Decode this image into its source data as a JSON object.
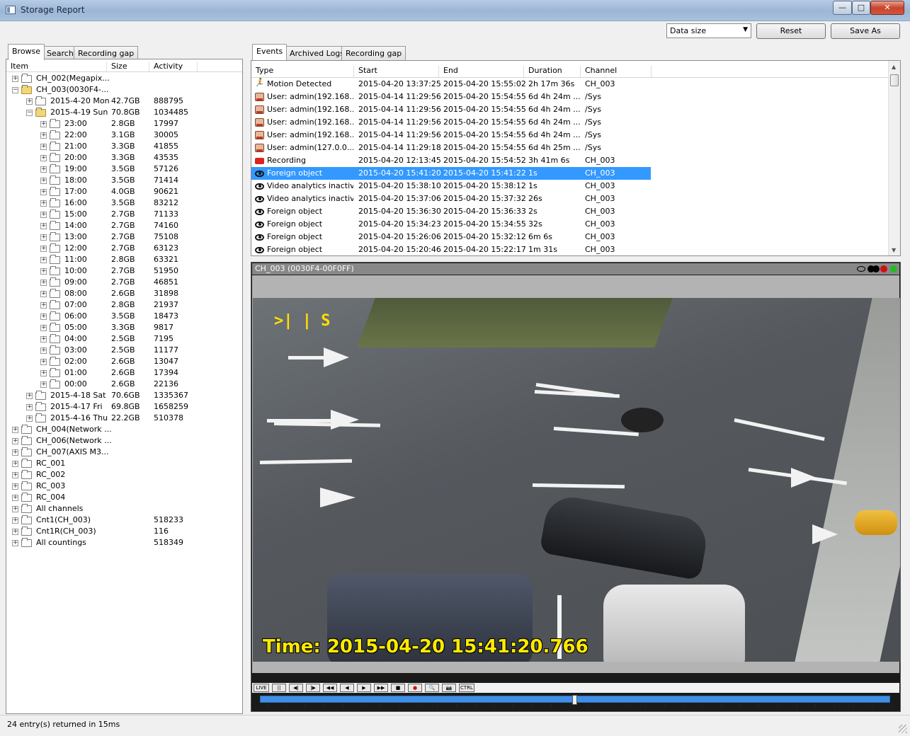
{
  "window": {
    "title": "Storage Report",
    "min": "—",
    "max": "□",
    "close": "✕"
  },
  "toolbar": {
    "datasize_value": "Data size",
    "reset_label": "Reset",
    "saveas_label": "Save As"
  },
  "left_tabs": [
    "Browse",
    "Search",
    "Recording gap"
  ],
  "tree_columns": [
    "Item",
    "Size",
    "Activity"
  ],
  "tree": [
    {
      "depth": 0,
      "exp": "+",
      "open": false,
      "name": "CH_002(Megapix...",
      "size": "",
      "activity": ""
    },
    {
      "depth": 0,
      "exp": "−",
      "open": true,
      "name": "CH_003(0030F4-...",
      "size": "",
      "activity": ""
    },
    {
      "depth": 1,
      "exp": "+",
      "open": false,
      "name": "2015-4-20 Mon",
      "size": "42.7GB",
      "activity": "888795"
    },
    {
      "depth": 1,
      "exp": "−",
      "open": true,
      "name": "2015-4-19 Sun",
      "size": "70.8GB",
      "activity": "1034485"
    },
    {
      "depth": 2,
      "exp": "+",
      "open": false,
      "name": "23:00",
      "size": "2.8GB",
      "activity": "17997"
    },
    {
      "depth": 2,
      "exp": "+",
      "open": false,
      "name": "22:00",
      "size": "3.1GB",
      "activity": "30005"
    },
    {
      "depth": 2,
      "exp": "+",
      "open": false,
      "name": "21:00",
      "size": "3.3GB",
      "activity": "41855"
    },
    {
      "depth": 2,
      "exp": "+",
      "open": false,
      "name": "20:00",
      "size": "3.3GB",
      "activity": "43535"
    },
    {
      "depth": 2,
      "exp": "+",
      "open": false,
      "name": "19:00",
      "size": "3.5GB",
      "activity": "57126"
    },
    {
      "depth": 2,
      "exp": "+",
      "open": false,
      "name": "18:00",
      "size": "3.5GB",
      "activity": "71414"
    },
    {
      "depth": 2,
      "exp": "+",
      "open": false,
      "name": "17:00",
      "size": "4.0GB",
      "activity": "90621"
    },
    {
      "depth": 2,
      "exp": "+",
      "open": false,
      "name": "16:00",
      "size": "3.5GB",
      "activity": "83212"
    },
    {
      "depth": 2,
      "exp": "+",
      "open": false,
      "name": "15:00",
      "size": "2.7GB",
      "activity": "71133"
    },
    {
      "depth": 2,
      "exp": "+",
      "open": false,
      "name": "14:00",
      "size": "2.7GB",
      "activity": "74160"
    },
    {
      "depth": 2,
      "exp": "+",
      "open": false,
      "name": "13:00",
      "size": "2.7GB",
      "activity": "75108"
    },
    {
      "depth": 2,
      "exp": "+",
      "open": false,
      "name": "12:00",
      "size": "2.7GB",
      "activity": "63123"
    },
    {
      "depth": 2,
      "exp": "+",
      "open": false,
      "name": "11:00",
      "size": "2.8GB",
      "activity": "63321"
    },
    {
      "depth": 2,
      "exp": "+",
      "open": false,
      "name": "10:00",
      "size": "2.7GB",
      "activity": "51950"
    },
    {
      "depth": 2,
      "exp": "+",
      "open": false,
      "name": "09:00",
      "size": "2.7GB",
      "activity": "46851"
    },
    {
      "depth": 2,
      "exp": "+",
      "open": false,
      "name": "08:00",
      "size": "2.6GB",
      "activity": "31898"
    },
    {
      "depth": 2,
      "exp": "+",
      "open": false,
      "name": "07:00",
      "size": "2.8GB",
      "activity": "21937"
    },
    {
      "depth": 2,
      "exp": "+",
      "open": false,
      "name": "06:00",
      "size": "3.5GB",
      "activity": "18473"
    },
    {
      "depth": 2,
      "exp": "+",
      "open": false,
      "name": "05:00",
      "size": "3.3GB",
      "activity": "9817"
    },
    {
      "depth": 2,
      "exp": "+",
      "open": false,
      "name": "04:00",
      "size": "2.5GB",
      "activity": "7195"
    },
    {
      "depth": 2,
      "exp": "+",
      "open": false,
      "name": "03:00",
      "size": "2.5GB",
      "activity": "11177"
    },
    {
      "depth": 2,
      "exp": "+",
      "open": false,
      "name": "02:00",
      "size": "2.6GB",
      "activity": "13047"
    },
    {
      "depth": 2,
      "exp": "+",
      "open": false,
      "name": "01:00",
      "size": "2.6GB",
      "activity": "17394"
    },
    {
      "depth": 2,
      "exp": "+",
      "open": false,
      "name": "00:00",
      "size": "2.6GB",
      "activity": "22136"
    },
    {
      "depth": 1,
      "exp": "+",
      "open": false,
      "name": "2015-4-18 Sat",
      "size": "70.6GB",
      "activity": "1335367"
    },
    {
      "depth": 1,
      "exp": "+",
      "open": false,
      "name": "2015-4-17 Fri",
      "size": "69.8GB",
      "activity": "1658259"
    },
    {
      "depth": 1,
      "exp": "+",
      "open": false,
      "name": "2015-4-16 Thu",
      "size": "22.2GB",
      "activity": "510378"
    },
    {
      "depth": 0,
      "exp": "+",
      "open": false,
      "name": "CH_004(Network ...",
      "size": "",
      "activity": ""
    },
    {
      "depth": 0,
      "exp": "+",
      "open": false,
      "name": "CH_006(Network ...",
      "size": "",
      "activity": ""
    },
    {
      "depth": 0,
      "exp": "+",
      "open": false,
      "name": "CH_007(AXIS M3...",
      "size": "",
      "activity": ""
    },
    {
      "depth": 0,
      "exp": "+",
      "open": false,
      "name": "RC_001",
      "size": "",
      "activity": ""
    },
    {
      "depth": 0,
      "exp": "+",
      "open": false,
      "name": "RC_002",
      "size": "",
      "activity": ""
    },
    {
      "depth": 0,
      "exp": "+",
      "open": false,
      "name": "RC_003",
      "size": "",
      "activity": ""
    },
    {
      "depth": 0,
      "exp": "+",
      "open": false,
      "name": "RC_004",
      "size": "",
      "activity": ""
    },
    {
      "depth": 0,
      "exp": "+",
      "open": false,
      "name": "All channels",
      "size": "",
      "activity": ""
    },
    {
      "depth": 0,
      "exp": "+",
      "open": false,
      "name": "Cnt1(CH_003)",
      "size": "",
      "activity": "518233"
    },
    {
      "depth": 0,
      "exp": "+",
      "open": false,
      "name": "Cnt1R(CH_003)",
      "size": "",
      "activity": "116"
    },
    {
      "depth": 0,
      "exp": "+",
      "open": false,
      "name": "All countings",
      "size": "",
      "activity": "518349"
    }
  ],
  "right_tabs": [
    "Events",
    "Archived Logs",
    "Recording gap"
  ],
  "event_columns": [
    "Type",
    "Start",
    "End",
    "Duration",
    "Channel"
  ],
  "events": [
    {
      "icon": "run-icon",
      "type": "Motion Detected",
      "start": "2015-04-20 13:37:25",
      "end": "2015-04-20 15:55:02",
      "duration": "2h 17m 36s",
      "channel": "CH_003",
      "selected": false
    },
    {
      "icon": "user-icon",
      "type": "User: admin(192.168....",
      "start": "2015-04-14 11:29:56",
      "end": "2015-04-20 15:54:55",
      "duration": "6d 4h 24m ...",
      "channel": "/Sys",
      "selected": false
    },
    {
      "icon": "user-icon",
      "type": "User: admin(192.168....",
      "start": "2015-04-14 11:29:56",
      "end": "2015-04-20 15:54:55",
      "duration": "6d 4h 24m ...",
      "channel": "/Sys",
      "selected": false
    },
    {
      "icon": "user-icon",
      "type": "User: admin(192.168....",
      "start": "2015-04-14 11:29:56",
      "end": "2015-04-20 15:54:55",
      "duration": "6d 4h 24m ...",
      "channel": "/Sys",
      "selected": false
    },
    {
      "icon": "user-icon",
      "type": "User: admin(192.168....",
      "start": "2015-04-14 11:29:56",
      "end": "2015-04-20 15:54:55",
      "duration": "6d 4h 24m ...",
      "channel": "/Sys",
      "selected": false
    },
    {
      "icon": "user-icon",
      "type": "User: admin(127.0.0....",
      "start": "2015-04-14 11:29:18",
      "end": "2015-04-20 15:54:55",
      "duration": "6d 4h 25m ...",
      "channel": "/Sys",
      "selected": false
    },
    {
      "icon": "recording-icon",
      "type": "Recording",
      "start": "2015-04-20 12:13:45",
      "end": "2015-04-20 15:54:52",
      "duration": "3h 41m 6s",
      "channel": "CH_003",
      "selected": false
    },
    {
      "icon": "eye-icon",
      "type": "Foreign object",
      "start": "2015-04-20 15:41:20",
      "end": "2015-04-20 15:41:22",
      "duration": "1s",
      "channel": "CH_003",
      "selected": true
    },
    {
      "icon": "eye-icon",
      "type": "Video analytics inactive",
      "start": "2015-04-20 15:38:10",
      "end": "2015-04-20 15:38:12",
      "duration": "1s",
      "channel": "CH_003",
      "selected": false
    },
    {
      "icon": "eye-icon",
      "type": "Video analytics inactive",
      "start": "2015-04-20 15:37:06",
      "end": "2015-04-20 15:37:32",
      "duration": "26s",
      "channel": "CH_003",
      "selected": false
    },
    {
      "icon": "eye-icon",
      "type": "Foreign object",
      "start": "2015-04-20 15:36:30",
      "end": "2015-04-20 15:36:33",
      "duration": "2s",
      "channel": "CH_003",
      "selected": false
    },
    {
      "icon": "eye-icon",
      "type": "Foreign object",
      "start": "2015-04-20 15:34:23",
      "end": "2015-04-20 15:34:55",
      "duration": "32s",
      "channel": "CH_003",
      "selected": false
    },
    {
      "icon": "eye-icon",
      "type": "Foreign object",
      "start": "2015-04-20 15:26:06",
      "end": "2015-04-20 15:32:12",
      "duration": "6m 6s",
      "channel": "CH_003",
      "selected": false
    },
    {
      "icon": "eye-icon",
      "type": "Foreign object",
      "start": "2015-04-20 15:20:46",
      "end": "2015-04-20 15:22:17",
      "duration": "1m 31s",
      "channel": "CH_003",
      "selected": false
    }
  ],
  "video": {
    "title": "CH_003 (0030F4-00F0FF)",
    "hud": ">| | S",
    "timestamp": "Time: 2015-04-20 15:41:20.766",
    "status_dots": [
      "#000000",
      "#000000",
      "#d01010",
      "#22bb22"
    ],
    "controls": [
      "LIVE",
      "||",
      "◀|",
      "|▶",
      "◀◀",
      "◀",
      "▶",
      "▶▶",
      "■",
      "●",
      "🔍",
      "📷",
      "CTRL"
    ]
  },
  "status": {
    "text": "24 entry(s) returned in 15ms"
  }
}
